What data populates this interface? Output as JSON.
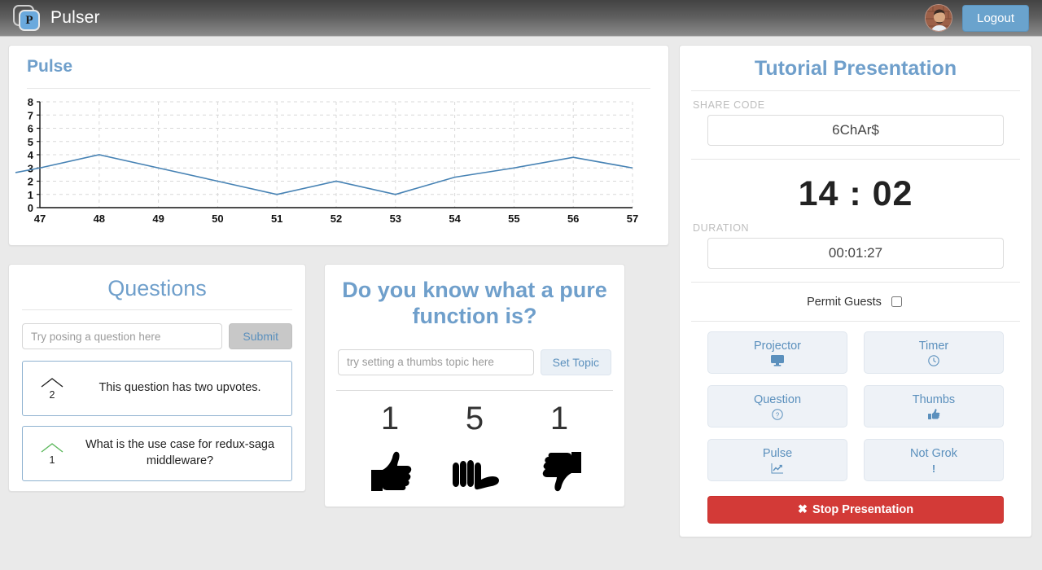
{
  "header": {
    "brand": "Pulser",
    "logo_letter": "P",
    "logo_icon": "pulser-logo-icon",
    "avatar_icon": "user-avatar",
    "logout_label": "Logout"
  },
  "pulse_panel": {
    "title": "Pulse"
  },
  "chart_data": {
    "type": "line",
    "title": "Pulse",
    "xlabel": "",
    "ylabel": "",
    "x": [
      47,
      48,
      49,
      50,
      51,
      52,
      53,
      54,
      55,
      56,
      57
    ],
    "values": [
      3,
      4,
      3,
      2,
      1,
      2,
      1,
      2.3,
      3,
      3.8,
      3
    ],
    "xtick_labels": [
      "47",
      "48",
      "49",
      "50",
      "51",
      "52",
      "53",
      "54",
      "55",
      "56",
      "57"
    ],
    "ytick_labels": [
      "0",
      "1",
      "2",
      "3",
      "4",
      "5",
      "6",
      "7",
      "8"
    ],
    "xlim": [
      47,
      57
    ],
    "ylim": [
      0,
      8
    ],
    "grid": true,
    "legend": "none",
    "line_color": "#4682b4"
  },
  "questions": {
    "title": "Questions",
    "input_placeholder": "Try posing a question here",
    "input_value": "",
    "submit_label": "Submit",
    "items": [
      {
        "votes": "2",
        "text": "This question has two upvotes.",
        "voted": false
      },
      {
        "votes": "1",
        "text": "What is the use case for redux-saga middleware?",
        "voted": true
      }
    ]
  },
  "thumbs": {
    "topic": "Do you know what a pure function is?",
    "input_placeholder": "try setting a thumbs topic here",
    "input_value": "",
    "set_topic_label": "Set Topic",
    "counts": [
      {
        "icon": "thumbs-up-icon",
        "value": "1"
      },
      {
        "icon": "thumbs-sideways-icon",
        "value": "5"
      },
      {
        "icon": "thumbs-down-icon",
        "value": "1"
      }
    ]
  },
  "presentation": {
    "title": "Tutorial Presentation",
    "share_code_label": "SHARE CODE",
    "share_code": "6ChAr$",
    "clock": "14 : 02",
    "duration_label": "DURATION",
    "duration": "00:01:27",
    "permit_guests_label": "Permit Guests",
    "permit_guests_checked": false,
    "controls": [
      {
        "label": "Projector",
        "icon": "monitor-icon",
        "glyph": "⎕"
      },
      {
        "label": "Timer",
        "icon": "clock-icon",
        "glyph": "◴"
      },
      {
        "label": "Question",
        "icon": "question-circle-icon",
        "glyph": "?"
      },
      {
        "label": "Thumbs",
        "icon": "thumbs-up-icon",
        "glyph": "■"
      },
      {
        "label": "Pulse",
        "icon": "chart-line-icon",
        "glyph": "↗"
      },
      {
        "label": "Not Grok",
        "icon": "exclamation-icon",
        "glyph": "!"
      }
    ],
    "stop_label": "Stop Presentation",
    "stop_icon": "close-x-icon"
  },
  "colors": {
    "accent_blue": "#6f9fcb",
    "danger_red": "#d33a37",
    "line_blue": "#4682b4"
  }
}
